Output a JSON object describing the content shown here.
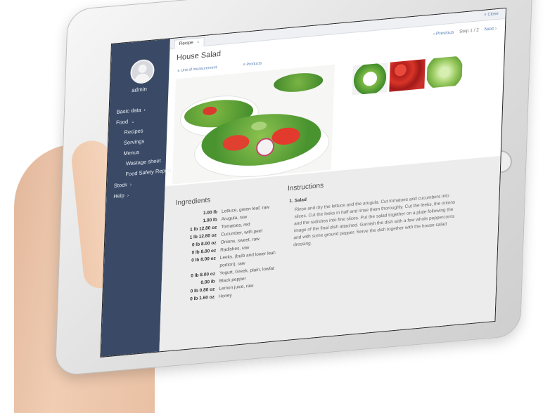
{
  "sidebar": {
    "user_name": "admin",
    "items": [
      {
        "label": "Basic data",
        "chevron": "›",
        "level": 0
      },
      {
        "label": "Food",
        "chevron": "⌄",
        "level": 0
      },
      {
        "label": "Recipes",
        "chevron": "",
        "level": 1
      },
      {
        "label": "Servings",
        "chevron": "",
        "level": 1
      },
      {
        "label": "Menus",
        "chevron": "",
        "level": 1
      },
      {
        "label": "Wastage sheet",
        "chevron": "",
        "level": 1
      },
      {
        "label": "Food Safety Report",
        "chevron": "",
        "level": 1
      },
      {
        "label": "Stock",
        "chevron": "›",
        "level": 0
      },
      {
        "label": "Help",
        "chevron": "›",
        "level": 0
      }
    ]
  },
  "topbar": {
    "tab_label": "Recipe",
    "tab_close": "×",
    "close_label": "× Close"
  },
  "recipe": {
    "title": "House Salad",
    "previous": "‹ Previous",
    "step": "Step 1 / 2",
    "next": "Next ›",
    "unit_link": "Unit of measurement",
    "products_link": "Products"
  },
  "ingredients": {
    "title": "Ingredients",
    "rows": [
      {
        "qty": "1.00 lb",
        "name": "Lettuce, green leaf, raw"
      },
      {
        "qty": "1.00 lb",
        "name": "Arugula, raw"
      },
      {
        "qty": "1 lb 12.80 oz",
        "name": "Tomatoes, red"
      },
      {
        "qty": "1 lb 12.80 oz",
        "name": "Cucumber, with peel"
      },
      {
        "qty": "0 lb 8.00 oz",
        "name": "Onions, sweet, raw"
      },
      {
        "qty": "0 lb 8.00 oz",
        "name": "Radishes, raw"
      },
      {
        "qty": "0 lb 8.00 oz",
        "name": "Leeks, (bulb and lower leaf-portion), raw"
      },
      {
        "qty": "0 lb 8.00 oz",
        "name": "Yogurt, Greek, plain, lowfat"
      },
      {
        "qty": "0.00 lb",
        "name": "Black pepper"
      },
      {
        "qty": "0 lb 0.80 oz",
        "name": "Lemon juice, raw"
      },
      {
        "qty": "0 lb 1.60 oz",
        "name": "Honey"
      }
    ]
  },
  "instructions": {
    "title": "Instructions",
    "step_label": "1. Salad",
    "text": "Rinse and dry the lettuce and the arugula. Cut tomatoes and cucumbers into slices. Cut the leeks in half and rinse them thoroughly. Cut the leeks, the onions and the radishes into fine slices. Put the salad together on a plate following the image of the final dish attached. Garnish the dish with a few whole peppercorns and with some ground pepper. Serve the dish together with the house salad dressing."
  }
}
